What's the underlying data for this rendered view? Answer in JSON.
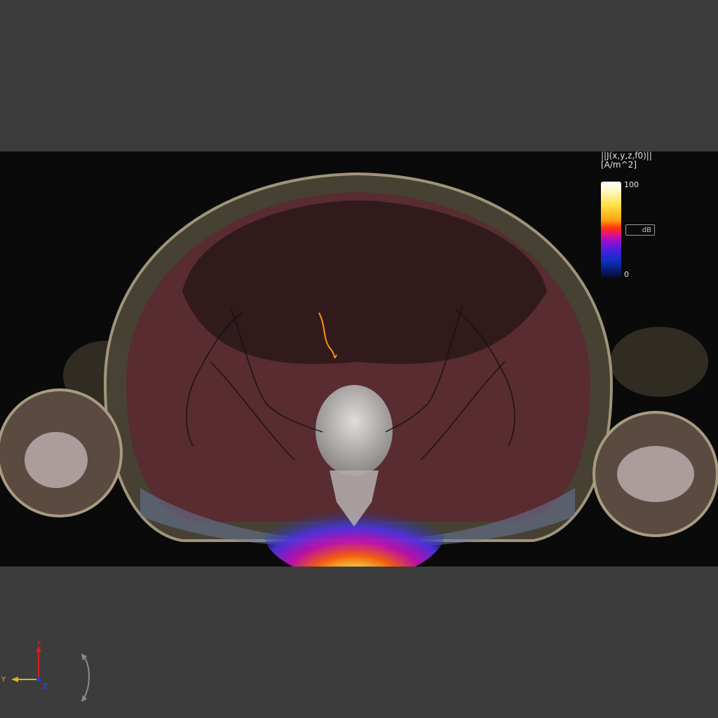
{
  "legend": {
    "title_line1": "||J(x,y,z,f0)||",
    "title_line2": "[A/m^2]",
    "max_label": "100",
    "min_label": "0",
    "db_label": "dB"
  },
  "axes": {
    "x_label": "X",
    "y_label": "Y",
    "z_label": "Z"
  },
  "colors": {
    "viewport_bg": "#0a0a0a",
    "frame_bg": "#3c3c3c",
    "tissue": "#5a2a30",
    "skin": "#8a8070"
  }
}
